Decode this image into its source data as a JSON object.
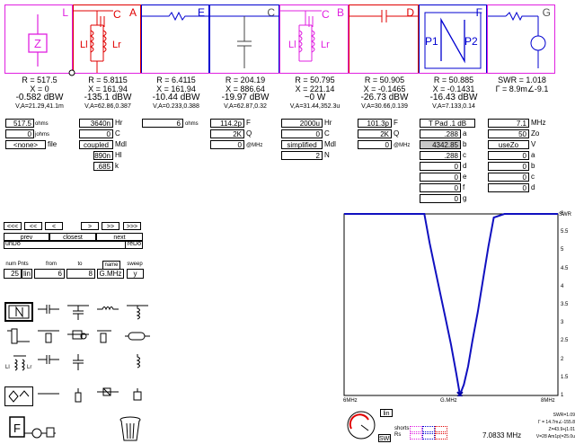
{
  "blocks": [
    {
      "label": "L",
      "name": "block-load",
      "border": "#e020e0"
    },
    {
      "label": "A",
      "name": "block-a",
      "border": "#e00000",
      "c": "C",
      "l1": "Ll",
      "l2": "Lr"
    },
    {
      "label": "E",
      "name": "block-e",
      "border": "#0000d0"
    },
    {
      "label": "C",
      "name": "block-c",
      "border": "#0000d0"
    },
    {
      "label": "B",
      "name": "block-b",
      "border": "#e020e0",
      "c": "C",
      "l1": "Ll",
      "l2": "Lr"
    },
    {
      "label": "D",
      "name": "block-d",
      "border": "#e00000"
    },
    {
      "label": "F",
      "name": "block-f",
      "border": "#0000d0",
      "p1": "P1",
      "p2": "P2"
    },
    {
      "label": "G",
      "name": "block-g",
      "border": "#e020e0"
    }
  ],
  "load_symbol": "Z",
  "summary": [
    {
      "r": "R = 517.5",
      "x": "X = 0",
      "pwr": "-0.582 dBW",
      "v": "V,A=21.29,41.1m"
    },
    {
      "r": "R = 5.8115",
      "x": "X = 161.94",
      "pwr": "-135.1 dBW",
      "v": "V,A=62.86,0.387"
    },
    {
      "r": "R = 6.4115",
      "x": "X = 161.94",
      "pwr": "-10.44 dBW",
      "v": "V,A=0.233,0.388"
    },
    {
      "r": "R = 204.19",
      "x": "X = 886.64",
      "pwr": "-19.97 dBW",
      "v": "V,A=62.87,0.32"
    },
    {
      "r": "R = 50.795",
      "x": "X = 221.14",
      "pwr": "~0 W",
      "v": "V,A=31.44,352.3u"
    },
    {
      "r": "R = 50.905",
      "x": "X = -0.1465",
      "pwr": "-26.73 dBW",
      "v": "V,A=30.66,0.139"
    },
    {
      "r": "R = 50.885",
      "x": "X = -0.1431",
      "pwr": "-16.43 dBW",
      "v": "V,A=7.133,0.14"
    },
    {
      "r": "SWR = 1.018",
      "x": "Γ = 8.9m∠-9.1",
      "pwr": "",
      "v": ""
    }
  ],
  "load_params": {
    "ohms": "517.5",
    "ohms_unit": "ohms",
    "jx": "0",
    "jx_unit": "johms",
    "file": "<none>",
    "file_label": "file"
  },
  "a_params": {
    "hr": "3640n",
    "hr_label": "Hr",
    "c": "0",
    "c_label": "C",
    "mdl": "coupled",
    "mdl_label": "Mdl",
    "hl": "890n",
    "hl_label": "Hl",
    "k": ".685",
    "k_label": "k"
  },
  "e_params": {
    "ohms": "6",
    "ohms_unit": "ohms"
  },
  "c_params": {
    "f": "114.2p",
    "f_label": "F",
    "q": "2K",
    "q_label": "Q",
    "at": "0",
    "at_label": "@MHz"
  },
  "b_params": {
    "hr": "2000u",
    "hr_label": "Hr",
    "c": "0",
    "c_label": "C",
    "mdl": "simplified",
    "mdl_label": "Mdl",
    "n": "2",
    "n_label": "N"
  },
  "d_params": {
    "f": "101.3p",
    "f_label": "F",
    "q": "2K",
    "q_label": "Q",
    "at": "0",
    "at_label": "@MHz"
  },
  "f_params": {
    "type": "T Pad .1 dB",
    "a": ".288",
    "a_label": "a",
    "b": "4342.85",
    "b_label": "b",
    "c": ".288",
    "c_label": "c",
    "d": "0",
    "d_label": "d",
    "e": "0",
    "e_label": "e",
    "f": "0",
    "f_label": "f",
    "g": "0",
    "g_label": "g"
  },
  "g_params": {
    "mhz": "7.1",
    "mhz_label": "MHz",
    "zo": "50",
    "zo_label": "Zo",
    "v": "useZo",
    "v_label": "V",
    "a": "0",
    "a_label": "a",
    "b": "0",
    "b_label": "b",
    "c": "0",
    "c_label": "c",
    "d": "0",
    "d_label": "d"
  },
  "nav": {
    "b1": "<<<",
    "b2": "<<",
    "b3": "<",
    "b4": ">",
    "b5": ">>",
    "b6": ">>>",
    "prev": "prev",
    "closest": "closest",
    "next": "next",
    "undo": "unDo",
    "redo": "reDo"
  },
  "sweep": {
    "num_label": "num Pnts",
    "from_label": "from",
    "to_label": "to",
    "name_label": "name",
    "sweep_label": "sweep",
    "num": "25",
    "lin": "lin",
    "from": "6",
    "to": "8",
    "name": "G.MHz",
    "y": "y"
  },
  "chart": {
    "swr_label": "SWR",
    "ticks": [
      "6",
      "5.5",
      "5",
      "4.5",
      "4",
      "3.5",
      "3",
      "2.5",
      "2",
      "1.5",
      "1"
    ],
    "x_left": "6MHz",
    "x_mid": "G.MHz",
    "x_right": "8MHz",
    "corner_swr": "SWR=1.09",
    "corner_g": "Γ = 14.7m∠-155.8",
    "corner_z": "Z=43.9+j1.01",
    "corner_va": "V=28 Am1p(=25.0u",
    "freq_readout": "7.0833 MHz",
    "lin_btn": "lin",
    "smith_btn": "SWR",
    "shorts_label": "shorts",
    "rs_label": "Rs"
  },
  "chart_data": {
    "type": "line",
    "title": "",
    "xlabel": "G.MHz",
    "ylabel": "SWR",
    "xlim": [
      6,
      8
    ],
    "ylim": [
      1,
      6
    ],
    "x": [
      6.0,
      6.25,
      6.5,
      6.75,
      6.8,
      6.85,
      6.9,
      6.95,
      7.0,
      7.05,
      7.083,
      7.12,
      7.16,
      7.2,
      7.25,
      7.3,
      7.35,
      7.4,
      7.5,
      8.0
    ],
    "series": [
      {
        "values": [
          6,
          6,
          6,
          6,
          5.2,
          4.5,
          3.8,
          3.1,
          2.4,
          1.6,
          1.02,
          1.3,
          1.8,
          2.5,
          3.3,
          4.2,
          5.1,
          5.9,
          6,
          6
        ]
      }
    ]
  }
}
